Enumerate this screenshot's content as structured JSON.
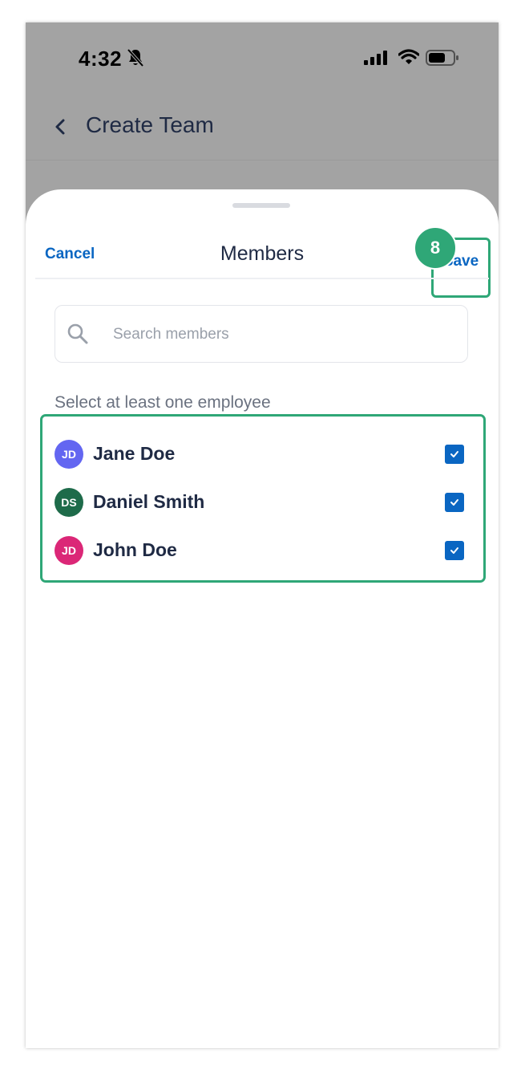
{
  "status_bar": {
    "time": "4:32"
  },
  "nav": {
    "title": "Create Team"
  },
  "sheet": {
    "cancel_label": "Cancel",
    "title": "Members",
    "save_label": "Save",
    "step_number": "8"
  },
  "search": {
    "placeholder": "Search members",
    "value": ""
  },
  "hint": "Select at least one employee",
  "members": [
    {
      "initials": "JD",
      "name": "Jane Doe",
      "avatar_color": "#6366f1",
      "checked": true
    },
    {
      "initials": "DS",
      "name": "Daniel Smith",
      "avatar_color": "#1e6b4a",
      "checked": true
    },
    {
      "initials": "JD",
      "name": "John Doe",
      "avatar_color": "#db2777",
      "checked": true
    }
  ],
  "colors": {
    "accent": "#0a66c2",
    "highlight": "#2fa777",
    "overlay": "#a3a3a3"
  }
}
